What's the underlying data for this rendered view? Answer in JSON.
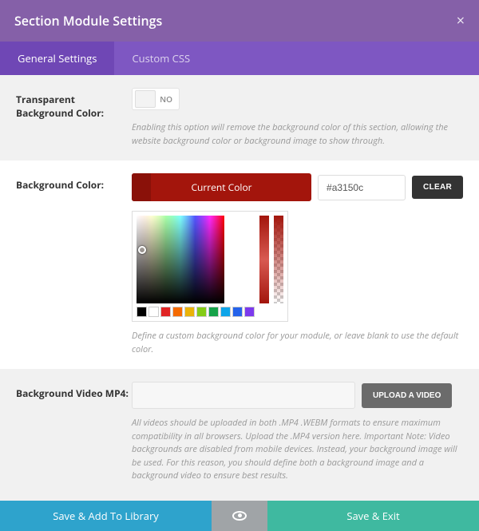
{
  "header": {
    "title": "Section Module Settings"
  },
  "tabs": {
    "general": "General Settings",
    "css": "Custom CSS"
  },
  "transparent": {
    "label": "Transparent Background Color:",
    "state": "NO",
    "help": "Enabling this option will remove the background color of this section, allowing the website background color or background image to show through."
  },
  "bgcolor": {
    "label": "Background Color:",
    "current_label": "Current Color",
    "hex_value": "#a3150c",
    "clear": "CLEAR",
    "help": "Define a custom background color for your module, or leave blank to use the default color.",
    "swatches": [
      "#000000",
      "#ffffff",
      "#e02424",
      "#f56a00",
      "#eab308",
      "#84cc16",
      "#16a34a",
      "#0ea5e9",
      "#2563eb",
      "#7c3aed"
    ]
  },
  "video": {
    "label": "Background Video MP4:",
    "value": "",
    "upload": "UPLOAD A VIDEO",
    "help": "All videos should be uploaded in both .MP4 .WEBM formats to ensure maximum compatibility in all browsers. Upload the .MP4 version here. Important Note: Video backgrounds are disabled from mobile devices. Instead, your background image will be used. For this reason, you should define both a background image and a background video to ensure best results."
  },
  "footer": {
    "save_lib": "Save & Add To Library",
    "save_exit": "Save & Exit"
  }
}
